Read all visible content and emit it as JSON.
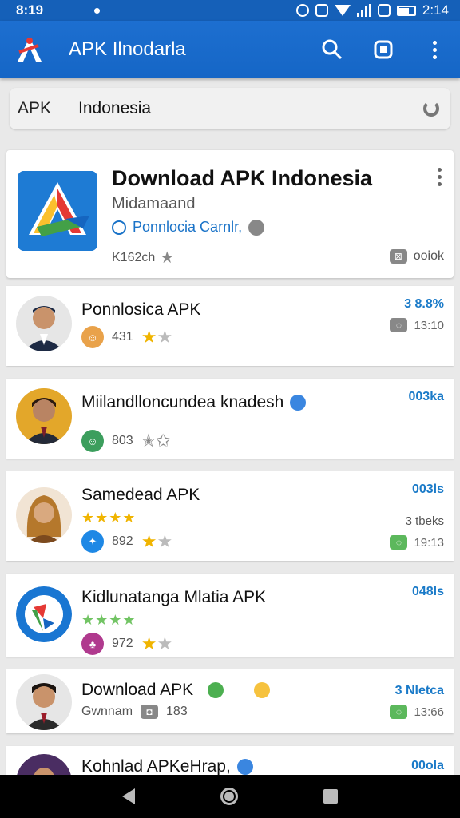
{
  "status": {
    "time": "8:19",
    "clock_right": "2:14"
  },
  "app_bar": {
    "title": "APK Ilnodarla"
  },
  "search": {
    "prefix": "APK",
    "value": "Indonesia"
  },
  "featured": {
    "title": "Download APK Indonesia",
    "subtitle": "Midamaand",
    "developer": "Ponnlocia Carnlr,",
    "size": "K162ch",
    "action": "ooiok",
    "icon_colors": [
      "#1e7bd4",
      "#e53935",
      "#fbc02d",
      "#43a047"
    ]
  },
  "items": [
    {
      "name": "Ponnlosica APK",
      "meta": "431",
      "stat_top": "3 8.8%",
      "stat_side": "13:10",
      "mini_color": "#e9a24a",
      "avatar": "#3b4a63"
    },
    {
      "name": "Miilandlloncundea knadesh",
      "meta": "803",
      "stat_top": "003ka",
      "mini_color": "#3c9e5d",
      "avatar": "#c98a1a"
    },
    {
      "name": "Samedead APK",
      "stars": "★★★★",
      "meta": "892",
      "stat_top": "003ls",
      "stat_extra": "3 tbeks",
      "stat_side": "19:13",
      "mini_color": "#1e88e5",
      "avatar": "#a36a2a"
    },
    {
      "name": "Kidlunatanga Mlatia APK",
      "stars": "★★★★",
      "meta": "972",
      "stat_top": "048ls",
      "mini_color": "#b03a8e",
      "avatar": "#1976d2"
    },
    {
      "name": "Download APK",
      "meta_label": "Gwnnam",
      "meta": "183",
      "stat_top": "3 Nletca",
      "stat_side": "13:66",
      "avatar": "#5a4633"
    },
    {
      "name": "Kohnlad APKeHrap,",
      "stat_top": "00ola",
      "avatar": "#4a2d62"
    }
  ]
}
